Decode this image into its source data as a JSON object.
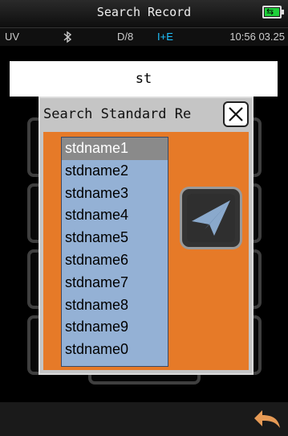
{
  "titlebar": {
    "title": "Search Record",
    "battery_icon": "battery-charging-icon",
    "battery_color": "#1fd13a"
  },
  "statusbar": {
    "mode": "UV",
    "bluetooth_icon": "bluetooth-icon",
    "geometry": "D/8",
    "spec_mode": "I+E",
    "datetime": "10:56 03.25",
    "spec_color": "#1fc3ff"
  },
  "search": {
    "value": "st"
  },
  "dialog": {
    "title": "Search Standard Re",
    "close_icon": "close-icon",
    "panel_color": "#e67a28",
    "list_color": "#94b1d5",
    "items": [
      "stdname1",
      "stdname2",
      "stdname3",
      "stdname4",
      "stdname5",
      "stdname6",
      "stdname7",
      "stdname8",
      "stdname9",
      "stdname0"
    ],
    "selected_index": 0,
    "send_icon": "paper-plane-icon"
  },
  "bottombar": {
    "back_icon": "back-arrow-icon"
  }
}
